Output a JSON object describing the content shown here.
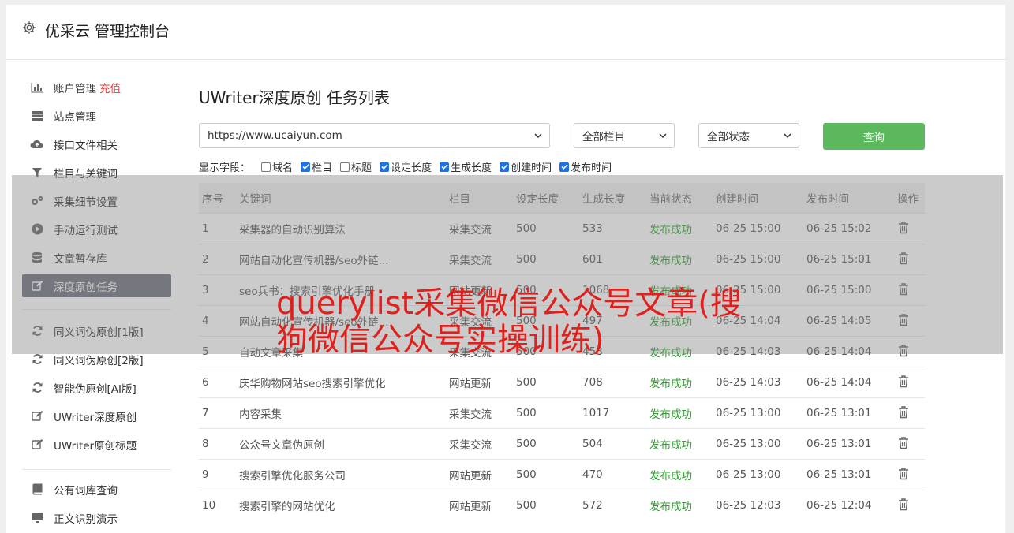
{
  "header": {
    "title": "优采云 管理控制台"
  },
  "sidebar": {
    "items": [
      {
        "label": "账户管理",
        "extra": "充值",
        "icon": "bar-chart-icon"
      },
      {
        "label": "站点管理",
        "icon": "server-icon"
      },
      {
        "label": "接口文件相关",
        "icon": "cloud-upload-icon"
      },
      {
        "label": "栏目与关键词",
        "icon": "filter-icon"
      },
      {
        "label": "采集细节设置",
        "icon": "gears-icon"
      },
      {
        "label": "手动运行测试",
        "icon": "play-circle-icon"
      },
      {
        "label": "文章暂存库",
        "icon": "database-icon"
      },
      {
        "label": "深度原创任务",
        "icon": "edit-icon"
      },
      {
        "label": "同义词伪原创[1版]",
        "icon": "refresh-icon"
      },
      {
        "label": "同义词伪原创[2版]",
        "icon": "refresh-icon"
      },
      {
        "label": "智能伪原创[AI版]",
        "icon": "refresh-icon"
      },
      {
        "label": "UWriter深度原创",
        "icon": "edit-icon"
      },
      {
        "label": "UWriter原创标题",
        "icon": "edit-icon"
      },
      {
        "label": "公有词库查询",
        "icon": "book-icon"
      },
      {
        "label": "正文识别演示",
        "icon": "monitor-icon"
      }
    ]
  },
  "page": {
    "title": "UWriter深度原创 任务列表",
    "site_select": "https://www.ucaiyun.com",
    "column_select": "全部栏目",
    "status_select": "全部状态",
    "query_button": "查询",
    "fields_label": "显示字段：",
    "fields": [
      {
        "label": "域名",
        "checked": false
      },
      {
        "label": "栏目",
        "checked": true
      },
      {
        "label": "标题",
        "checked": false
      },
      {
        "label": "设定长度",
        "checked": true
      },
      {
        "label": "生成长度",
        "checked": true
      },
      {
        "label": "创建时间",
        "checked": true
      },
      {
        "label": "发布时间",
        "checked": true
      }
    ]
  },
  "table": {
    "headers": [
      "序号",
      "关键词",
      "栏目",
      "设定长度",
      "生成长度",
      "当前状态",
      "创建时间",
      "发布时间",
      "操作"
    ],
    "rows": [
      [
        "1",
        "采集器的自动识别算法",
        "采集交流",
        "500",
        "533",
        "发布成功",
        "06-25 15:00",
        "06-25 15:02"
      ],
      [
        "2",
        "网站自动化宣传机器/seo外链...",
        "采集交流",
        "500",
        "601",
        "发布成功",
        "06-25 15:00",
        "06-25 15:01"
      ],
      [
        "3",
        "seo兵书：搜索引擎优化手册",
        "网站更新",
        "500",
        "1068",
        "发布成功",
        "06-25 15:00",
        "06-25 15:00"
      ],
      [
        "4",
        "网站自动化宣传机器/seo外链...",
        "采集交流",
        "500",
        "497",
        "发布成功",
        "06-25 14:04",
        "06-25 14:05"
      ],
      [
        "5",
        "自动文章采集",
        "采集交流",
        "500",
        "458",
        "发布成功",
        "06-25 14:03",
        "06-25 14:04"
      ],
      [
        "6",
        "庆华购物网站seo搜索引擎优化",
        "网站更新",
        "500",
        "708",
        "发布成功",
        "06-25 14:03",
        "06-25 14:04"
      ],
      [
        "7",
        "内容采集",
        "采集交流",
        "500",
        "1017",
        "发布成功",
        "06-25 13:00",
        "06-25 13:01"
      ],
      [
        "8",
        "公众号文章伪原创",
        "采集交流",
        "500",
        "504",
        "发布成功",
        "06-25 13:00",
        "06-25 13:01"
      ],
      [
        "9",
        "搜索引擎优化服务公司",
        "网站更新",
        "500",
        "470",
        "发布成功",
        "06-25 13:00",
        "06-25 13:01"
      ],
      [
        "10",
        "搜索引擎的网站优化",
        "网站更新",
        "500",
        "572",
        "发布成功",
        "06-25 12:03",
        "06-25 12:04"
      ]
    ]
  },
  "watermark": {
    "text": "querylist采集微信公众号文章(搜狗微信公众号实操训练)"
  },
  "colors": {
    "accent": "#5cb85c",
    "status_ok": "#2e9e2e",
    "watermark": "#e0201c",
    "active_nav": "#6c6f7a"
  }
}
